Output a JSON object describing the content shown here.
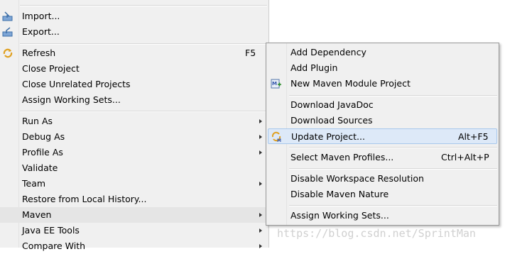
{
  "main_menu": {
    "import_label": "Import...",
    "export_label": "Export...",
    "refresh_label": "Refresh",
    "refresh_accel": "F5",
    "close_project_label": "Close Project",
    "close_unrelated_label": "Close Unrelated Projects",
    "assign_working_sets_label": "Assign Working Sets...",
    "run_as_label": "Run As",
    "debug_as_label": "Debug As",
    "profile_as_label": "Profile As",
    "validate_label": "Validate",
    "team_label": "Team",
    "restore_history_label": "Restore from Local History...",
    "maven_label": "Maven",
    "java_ee_tools_label": "Java EE Tools",
    "compare_with_label": "Compare With"
  },
  "maven_submenu": {
    "add_dependency_label": "Add Dependency",
    "add_plugin_label": "Add Plugin",
    "new_module_label": "New Maven Module Project",
    "download_javadoc_label": "Download JavaDoc",
    "download_sources_label": "Download Sources",
    "update_project_label": "Update Project...",
    "update_project_accel": "Alt+F5",
    "select_profiles_label": "Select Maven Profiles...",
    "select_profiles_accel": "Ctrl+Alt+P",
    "disable_workspace_label": "Disable Workspace Resolution",
    "disable_nature_label": "Disable Maven Nature",
    "assign_working_sets_label": "Assign Working Sets..."
  },
  "watermark": "https://blog.csdn.net/SprintMan",
  "colors": {
    "menu_bg": "#f0f0f0",
    "highlight_gray": "#e5e5e5",
    "highlight_blue": "#dde9f8"
  }
}
